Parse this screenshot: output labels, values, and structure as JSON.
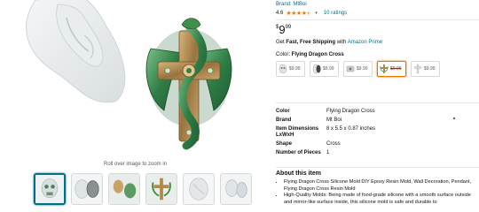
{
  "gallery": {
    "zoom_hint": "Roll over image to zoom in",
    "thumbnails": [
      {
        "name": "thumbnail-1",
        "selected": true
      },
      {
        "name": "thumbnail-2",
        "selected": false
      },
      {
        "name": "thumbnail-3",
        "selected": false
      },
      {
        "name": "thumbnail-4",
        "selected": false
      },
      {
        "name": "thumbnail-5",
        "selected": false
      },
      {
        "name": "thumbnail-6",
        "selected": false
      }
    ]
  },
  "product": {
    "brand_link": "Brand: MtBoi",
    "rating": "4.6",
    "stars_filled": 4.5,
    "ratings_link": "10 ratings",
    "price_symbol": "$",
    "price_whole": "9",
    "price_fraction": "99",
    "shipping_prefix": "Get ",
    "shipping_bold": "Fast, Free Shipping",
    "shipping_middle": " with ",
    "shipping_prime": "Amazon Prime",
    "color_label": "Color: ",
    "color_value": "Flying Dragon Cross",
    "swatches": [
      {
        "price": "$9.99",
        "selected": false,
        "icon": "skull-mold-icon"
      },
      {
        "price": "$9.99",
        "selected": false,
        "icon": "dark-mold-icon"
      },
      {
        "price": "$9.99",
        "selected": false,
        "icon": "tray-mold-icon"
      },
      {
        "price": "$9.99",
        "selected": true,
        "icon": "dragon-cross-icon"
      },
      {
        "price": "$9.99",
        "selected": false,
        "icon": "cross-mold-icon"
      }
    ],
    "specs": [
      {
        "key": "Color",
        "value": "Flying Dragon Cross"
      },
      {
        "key": "Brand",
        "value": "Mt Boi"
      },
      {
        "key": "Item Dimensions LxWxH",
        "value": "8 x 5.5 x 0.87 inches"
      },
      {
        "key": "Shape",
        "value": "Cross"
      },
      {
        "key": "Number of Pieces",
        "value": "1"
      }
    ],
    "about_title": "About this item",
    "bullets": [
      "Flying Dragon Cross Silicone Mold DIY Epoxy Resin Mold, Wall Decoration, Pendant, Flying Dragon Cross Resin Mold",
      "High-Quality Molds: Being made of food-grade silicone with a smooth surface outside and mirror-like surface inside, this silicone mold is safe and durable to"
    ]
  },
  "colors": {
    "link": "#007185",
    "star": "#de7921",
    "selected_swatch": "#e77600",
    "dragon_green": "#3f8f4a",
    "cross_gold": "#b08a4a"
  }
}
